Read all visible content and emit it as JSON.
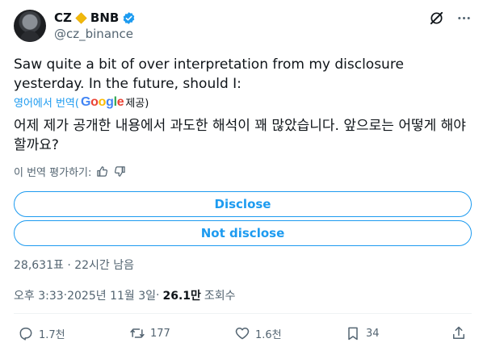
{
  "author": {
    "display_name": "CZ",
    "brand_badge": "BNB",
    "handle": "@cz_binance",
    "badge_icon": "bnb-diamond-icon",
    "verified_icon": "verified-badge-icon",
    "accent_color": "#1d9bf0"
  },
  "tweet": {
    "text": "Saw quite a bit of over interpretation from my disclosure yesterday. In the future, should I:",
    "translate_prefix": "영어에서 번역(",
    "translate_provider": "Google",
    "translate_suffix": " 제공)",
    "translated_text": "어제 제가 공개한 내용에서 과도한 해석이 꽤 많았습니다. 앞으로는 어떻게 해야 할까요?",
    "rate_translation": "이 번역 평가하기:"
  },
  "poll": {
    "options": [
      "Disclose",
      "Not disclose"
    ],
    "votes": "28,631표",
    "time_left": "22시간 남음",
    "separator": " · "
  },
  "meta": {
    "time": "오후 3:33",
    "date": "2025년 11월 3일",
    "separator": " · ",
    "views_count": "26.1만",
    "views_label": "조회수"
  },
  "actions": {
    "replies": "1.7천",
    "retweets": "177",
    "likes": "1.6천",
    "bookmarks": "34"
  },
  "google_colors": [
    "#4285F4",
    "#EA4335",
    "#FBBC05",
    "#4285F4",
    "#34A853",
    "#EA4335"
  ]
}
